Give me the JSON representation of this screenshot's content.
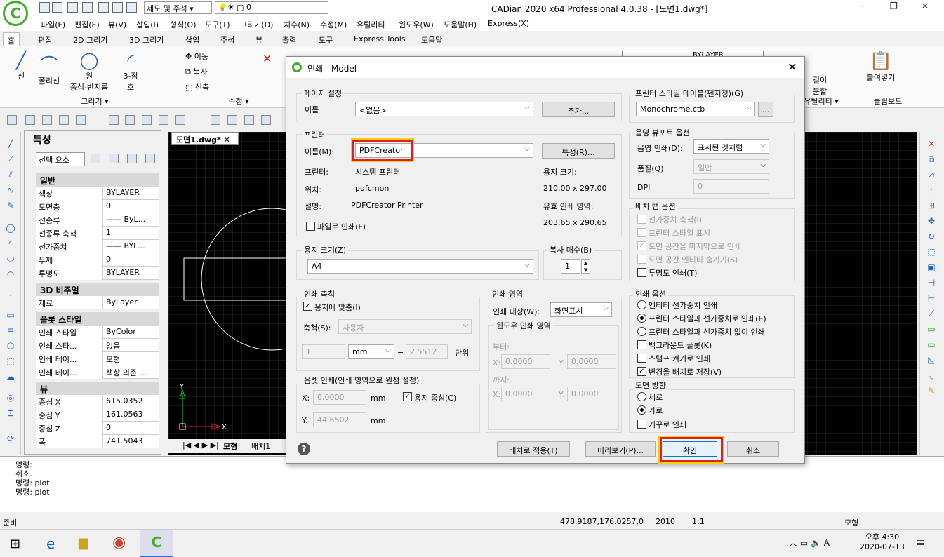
{
  "app": {
    "title": "CADian 2020 x64 Professional 4.0.38 - [도면1.dwg*]"
  },
  "quick": {
    "style_select": "제도 및 주석",
    "layer_select": "0"
  },
  "menu": [
    "파일(F)",
    "편집(E)",
    "뷰(V)",
    "삽입(I)",
    "형식(O)",
    "도구(T)",
    "그리기(D)",
    "치수(N)",
    "수정(M)",
    "유틸리티",
    "윈도우(W)",
    "도움말(H)",
    "Express(X)"
  ],
  "tabs": [
    "홈",
    "편집",
    "2D 그리기",
    "3D 그리기",
    "삽입",
    "주석",
    "뷰",
    "출력",
    "도구",
    "Express Tools",
    "도움말"
  ],
  "ribbon": {
    "line": "선",
    "polyline": "폴리선",
    "circle": "원",
    "circle_sub": "중심-반지름",
    "arc": "3-점",
    "arc_sub": "호",
    "group_draw": "그리기",
    "move": "이동",
    "copy": "복사",
    "stretch": "신축",
    "group_modify": "수정",
    "length": "길이",
    "split": "분할",
    "group_util": "유틸리티",
    "paste": "붙여넣기",
    "group_clip": "클립보드",
    "layer_val": "BYLAYER"
  },
  "props": {
    "title": "특성",
    "selector": "선택 요소",
    "sections": [
      {
        "name": "일반",
        "rows": [
          [
            "색상",
            "BYLAYER"
          ],
          [
            "도면층",
            "0"
          ],
          [
            "선종류",
            "—— ByL..."
          ],
          [
            "선종류 축척",
            "1"
          ],
          [
            "선가중치",
            "—— BYL..."
          ],
          [
            "두께",
            "0"
          ],
          [
            "투명도",
            "BYLAYER"
          ]
        ]
      },
      {
        "name": "3D 비주얼",
        "rows": [
          [
            "재료",
            "ByLayer"
          ]
        ]
      },
      {
        "name": "플롯 스타일",
        "rows": [
          [
            "인쇄 스타일",
            "ByColor"
          ],
          [
            "인쇄 스타...",
            "없음"
          ],
          [
            "인쇄 테이...",
            "모형"
          ],
          [
            "인쇄 테이...",
            "색상 의존 ..."
          ]
        ]
      },
      {
        "name": "뷰",
        "rows": [
          [
            "중심 X",
            "615.0352"
          ],
          [
            "중심 Y",
            "161.0563"
          ],
          [
            "중심 Z",
            "0"
          ],
          [
            "폭",
            "741.5043"
          ]
        ]
      }
    ]
  },
  "drawing": {
    "tab": "도면1.dwg*",
    "axis_x": "X",
    "axis_y": "Y",
    "layout_tabs": [
      "모형",
      "배치1"
    ]
  },
  "cmd": {
    "lines": [
      "명령:",
      "취소.",
      "명령: plot",
      "명령: plot"
    ]
  },
  "status": {
    "ready": "준비",
    "coords": "478.9187,176.0257,0",
    "year": "2010",
    "scale": "1:1",
    "model": "모형"
  },
  "taskbar": {
    "time": "오후 4:30",
    "date": "2020-07-13"
  },
  "dialog": {
    "title": "인쇄 - Model",
    "page_setup": {
      "group": "페이지 설정",
      "name_label": "이름",
      "name_value": "<없음>",
      "add_button": "추가..."
    },
    "printer": {
      "group": "프린터",
      "name_label": "이름(M):",
      "name_value": "PDFCreator",
      "props_button": "특성(R)...",
      "printer_label": "프린터:",
      "printer_value": "시스템 프린터",
      "where_label": "위치:",
      "where_value": "pdfcmon",
      "desc_label": "설명:",
      "desc_value": "PDFCreator Printer",
      "paper_size_label": "용지 크기:",
      "paper_size_value": "210.00 x 297.00",
      "printable_label": "유효 인쇄 영역:",
      "printable_value": "203.65 x 290.65",
      "to_file": "파일로 인쇄(F)"
    },
    "paper": {
      "group": "용지 크기(Z)",
      "value": "A4"
    },
    "copies": {
      "group": "복사 매수(B)",
      "value": "1"
    },
    "scale": {
      "group": "인쇄 축척",
      "fit": "용지에 맞춤(I)",
      "scale_label": "축척(S):",
      "scale_value": "사용자",
      "v1": "1",
      "unit": "mm",
      "eq": "=",
      "v2": "2.5512",
      "unit2": "단위"
    },
    "area": {
      "group": "인쇄 영역",
      "target_label": "인쇄 대상(W):",
      "target_value": "화면표시",
      "win_group": "윈도우 인쇄 영역",
      "from": "부터:",
      "to": "까지:",
      "x": "X:",
      "y": "Y:",
      "x1": "0.0000",
      "y1": "0.0000",
      "x2": "0.0000",
      "y2": "0.0000"
    },
    "offset": {
      "group": "옵셋 인쇄(인쇄 영역으로 원점 설정)",
      "x_label": "X:",
      "x_value": "0.0000",
      "y_label": "Y:",
      "y_value": "44.6502",
      "unit": "mm",
      "center": "용지 중심(C)"
    },
    "style_table": {
      "group": "프린터 스타일 테이블(펜지정)(G)",
      "value": "Monochrome.ctb",
      "btn": "..."
    },
    "shade": {
      "group": "음영 뷰포트 옵션",
      "shade_label": "음영 인쇄(D):",
      "shade_value": "표시된 것처럼",
      "quality_label": "품질(Q)",
      "quality_value": "일반",
      "dpi_label": "DPI",
      "dpi_value": "0"
    },
    "layout_opts": {
      "group": "배치 탭 옵션",
      "items": [
        "선가중치 축척(I)",
        "프린터 스타일 표시",
        "도면 공간을 마지막으로 인쇄",
        "도면 공간 엔티티 숨기기(S)",
        "투명도 인쇄(T)"
      ]
    },
    "print_opts": {
      "group": "인쇄 옵션",
      "items": [
        "엔티티 선가중치 인쇄",
        "프린터 스타일과 선가중치로 인쇄(E)",
        "프린터 스타일과 선가중치 없이 인쇄",
        "백그라운드 플롯(K)",
        "스탬프 켜기로 인쇄",
        "변경을 배치로 저장(V)"
      ]
    },
    "orient": {
      "group": "도면 방향",
      "portrait": "세로",
      "landscape": "가로",
      "upside": "거꾸로 인쇄"
    },
    "buttons": {
      "apply": "배치로 적용(T)",
      "preview": "미리보기(P)...",
      "ok": "확인",
      "cancel": "취소",
      "help": "?"
    }
  }
}
